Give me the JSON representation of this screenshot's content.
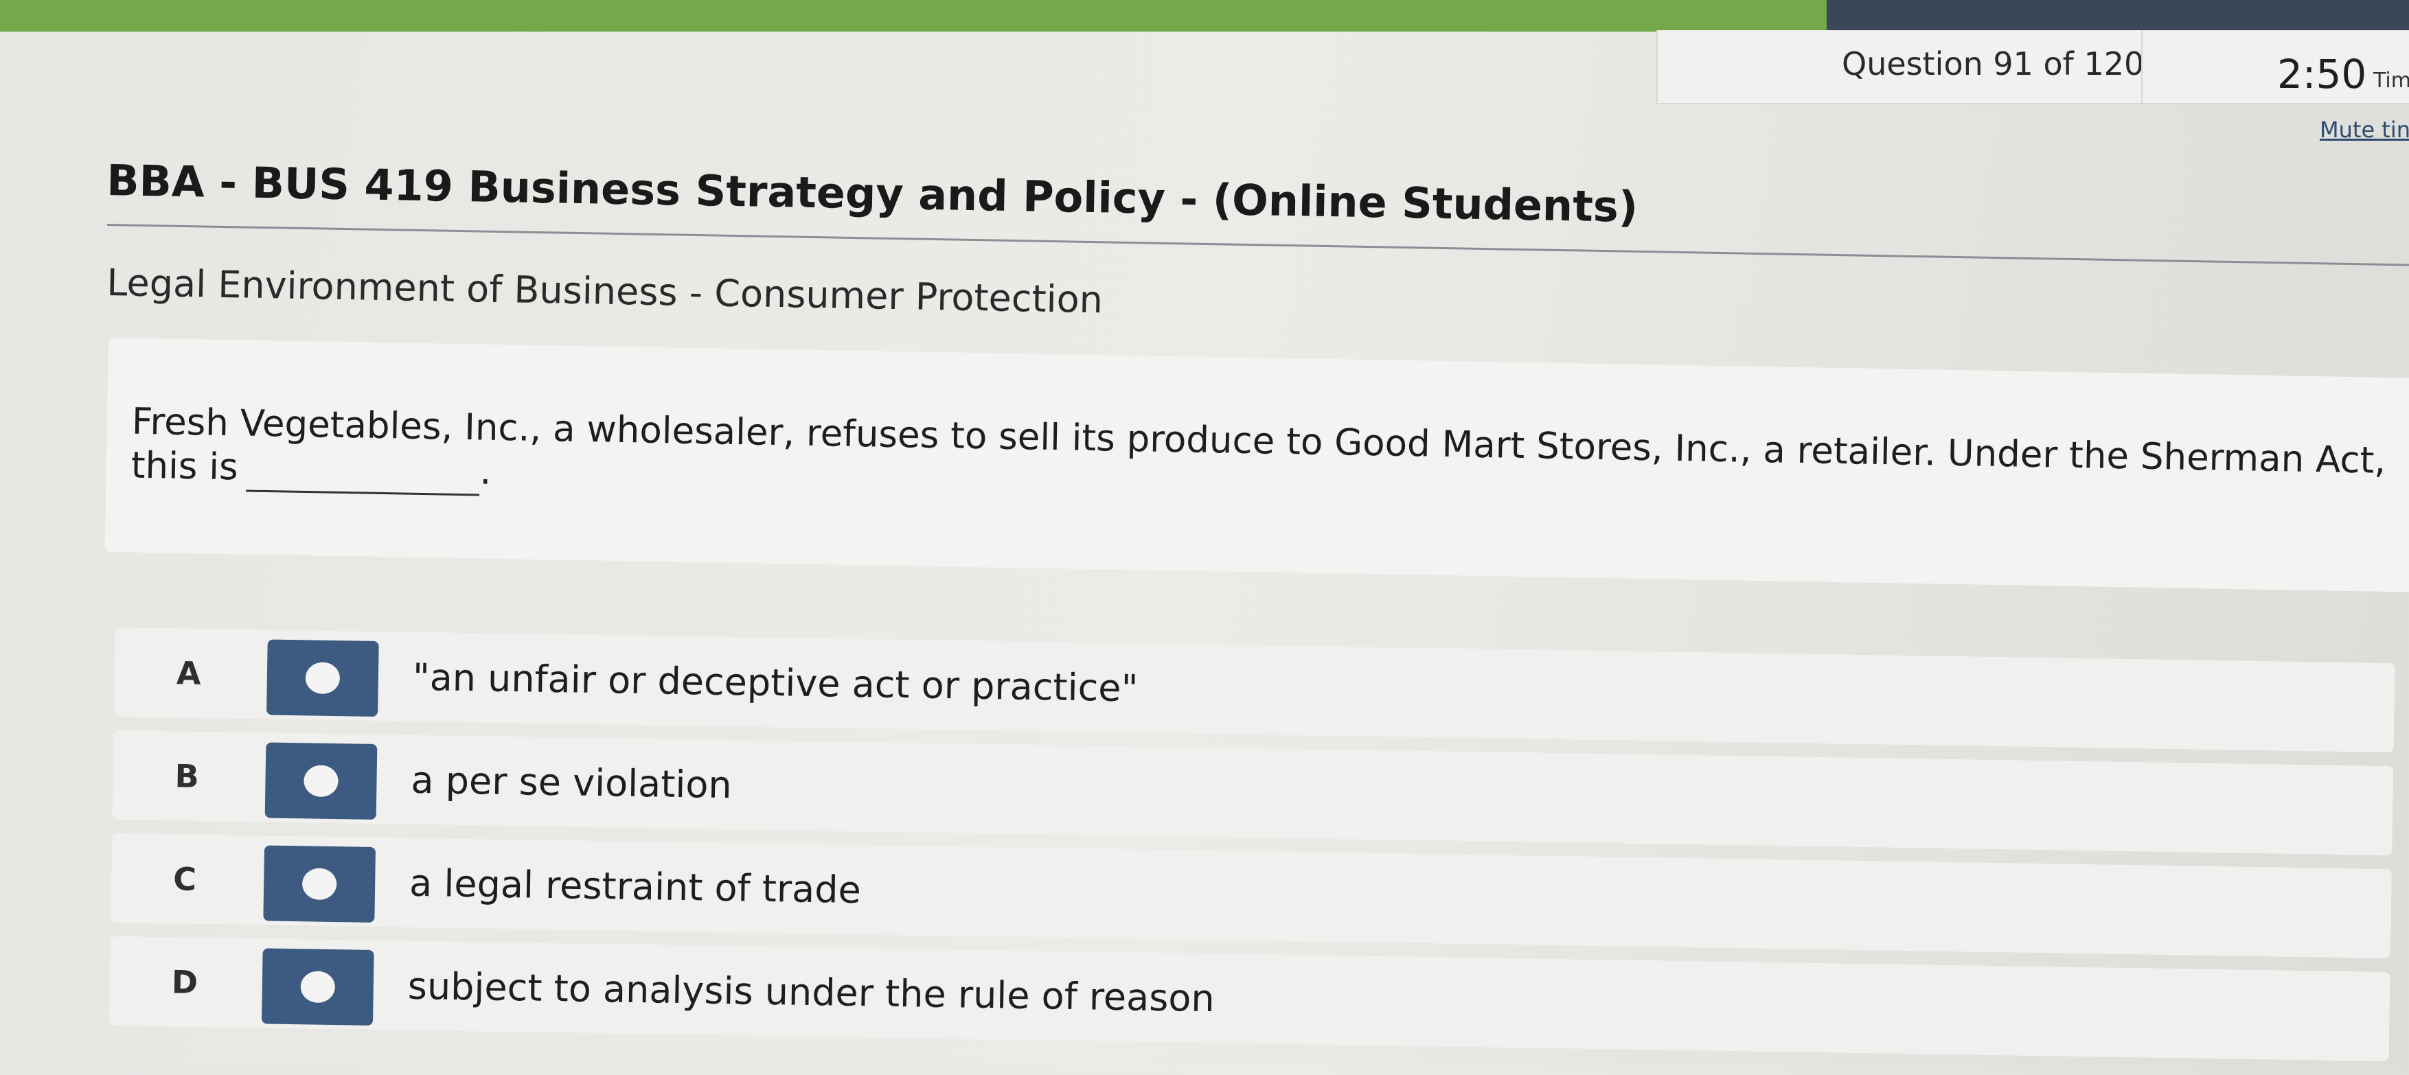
{
  "progress": {
    "fraction": 0.7583
  },
  "status": {
    "question_counter": "Question 91 of 120",
    "timer_value": "2:50",
    "timer_label": "Tim",
    "mute_link": "Mute tin"
  },
  "header": {
    "course_title": "BBA - BUS 419 Business Strategy and Policy - (Online Students)",
    "topic": "Legal Environment of Business - Consumer Protection"
  },
  "question": {
    "text_before_blank": "Fresh Vegetables, Inc., a wholesaler, refuses to sell its produce to Good Mart Stores, Inc., a retailer. Under the Sherman Act, this is",
    "text_after_blank": "."
  },
  "options": [
    {
      "letter": "A",
      "text": "\"an unfair or deceptive act or practice\""
    },
    {
      "letter": "B",
      "text": "a per se violation"
    },
    {
      "letter": "C",
      "text": "a legal restraint of trade"
    },
    {
      "letter": "D",
      "text": "subject to analysis under the rule of reason"
    }
  ],
  "colors": {
    "progress_fill": "#73a94b",
    "progress_remaining": "#3b4656",
    "radio_button": "#3d5a80"
  }
}
